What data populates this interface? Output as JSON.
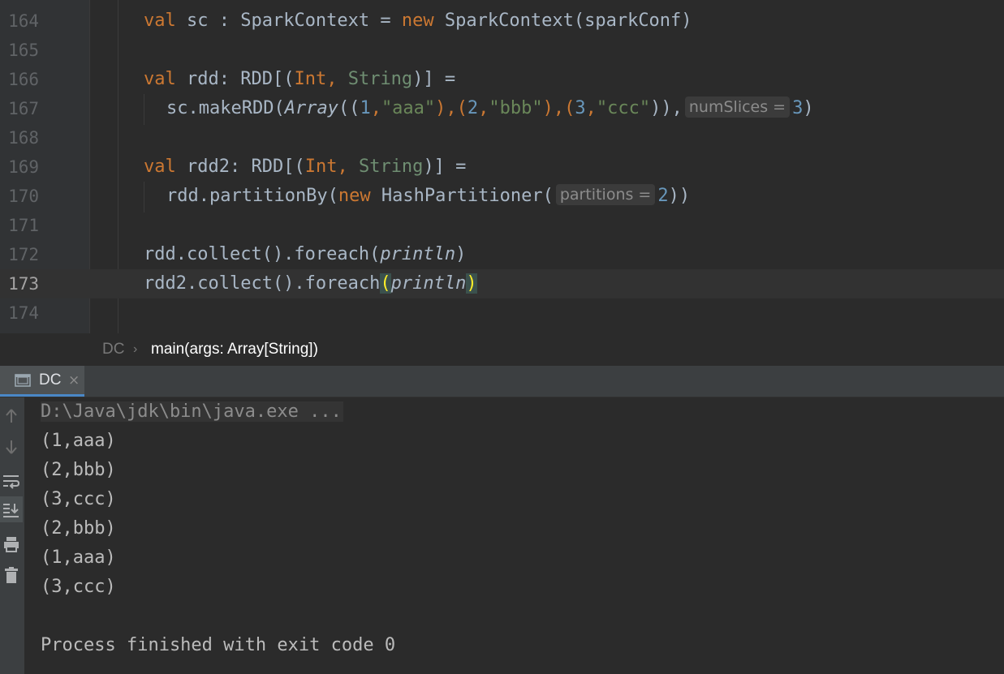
{
  "editor": {
    "lines": [
      {
        "num": "164"
      },
      {
        "num": "165"
      },
      {
        "num": "166"
      },
      {
        "num": "167"
      },
      {
        "num": "168"
      },
      {
        "num": "169"
      },
      {
        "num": "170"
      },
      {
        "num": "171"
      },
      {
        "num": "172"
      },
      {
        "num": "173"
      },
      {
        "num": "174"
      }
    ],
    "code": {
      "l164": {
        "kw_val": "val",
        "ident": " sc : SparkContext = ",
        "kw_new": "new",
        "rest": " SparkContext(sparkConf)"
      },
      "l166": {
        "kw_val": "val",
        "ident": " rdd: RDD[(",
        "t_int": "Int",
        "comma": ", ",
        "t_string": "String",
        "rest": ")] ="
      },
      "l167": {
        "p1": "sc.makeRDD(",
        "array": "Array",
        "p2": "((",
        "n1": "1",
        "c1": ",",
        "s1": "\"aaa\"",
        "p3": "),(",
        "n2": "2",
        "c2": ",",
        "s2": "\"bbb\"",
        "p4": "),(",
        "n3": "3",
        "c3": ",",
        "s3": "\"ccc\"",
        "p5": ")),",
        "hint": "numSlices =",
        "n4": "3",
        "p6": ")"
      },
      "l169": {
        "kw_val": "val",
        "ident": " rdd2: RDD[(",
        "t_int": "Int",
        "comma": ", ",
        "t_string": "String",
        "rest": ")] ="
      },
      "l170": {
        "p1": "rdd.partitionBy(",
        "kw_new": "new",
        "p2": " HashPartitioner(",
        "hint": "partitions =",
        "n1": "2",
        "p3": "))"
      },
      "l172": {
        "p1": "rdd.collect().foreach(",
        "fn": "println",
        "p2": ")"
      },
      "l173": {
        "p1": "rdd2.collect().foreach",
        "open": "(",
        "fn": "println",
        "close": ")"
      }
    }
  },
  "breadcrumb": {
    "class_name": "DC",
    "method": "main(args: Array[String])"
  },
  "run_panel": {
    "tab_label": "DC",
    "tab_close": "×",
    "command": "D:\\Java\\jdk\\bin\\java.exe ...",
    "output_lines": [
      "(1,aaa)",
      "(2,bbb)",
      "(3,ccc)",
      "(2,bbb)",
      "(1,aaa)",
      "(3,ccc)"
    ],
    "finish_message": "Process finished with exit code 0"
  },
  "colors": {
    "keyword": "#cc7832",
    "string": "#6a8759",
    "number": "#6897bb",
    "text": "#a9b7c6",
    "background": "#2b2b2b",
    "gutter": "#313335"
  },
  "toolbar_icons": [
    "arrow-up-icon",
    "arrow-down-icon",
    "soft-wrap-icon",
    "scroll-to-end-icon",
    "print-icon",
    "trash-icon"
  ]
}
